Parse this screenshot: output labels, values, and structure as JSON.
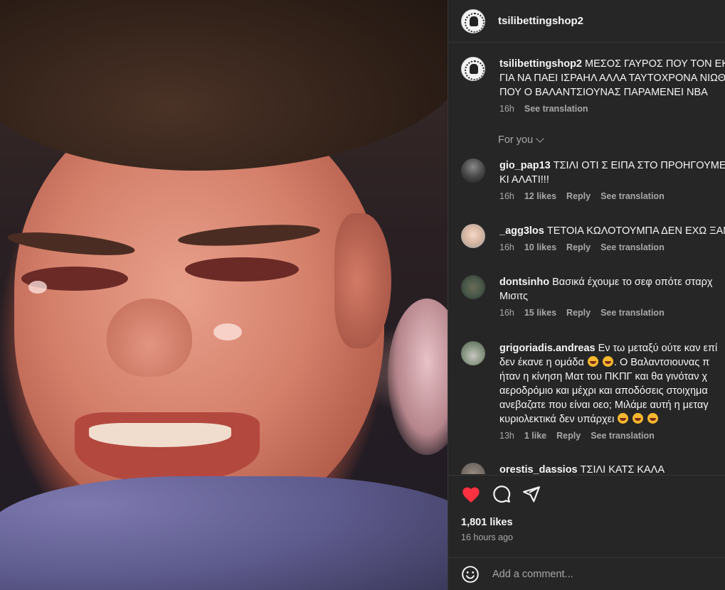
{
  "post": {
    "username": "tsilibettingshop2",
    "caption": {
      "username": "tsilibettingshop2",
      "lines": [
        "ΜΕΣΟΣ ΓΑΥΡΟΣ ΠΟΥ ΤΟΝ ΕΚ",
        "ΓΙΑ ΝΑ ΠΑΕΙ ΙΣΡΑΗΛ ΑΛΛΑ ΤΑΥΤΟΧΡΟΝΑ ΝΙΩΘ",
        "ΠΟΥ Ο ΒΑΛΑΝΤΣΙΟΥΝΑΣ ΠΑΡΑΜΕΝΕΙ ΝΒΑ"
      ],
      "time": "16h",
      "see_translation": "See translation"
    },
    "filter_label": "For you",
    "comments": [
      {
        "username": "gio_pap13",
        "lines": [
          "ΤΣΙΛΙ ΟΤΙ Σ ΕΙΠΑ ΣΤΟ ΠΡΟΗΓΟΥΜΕΝ",
          "ΚΙ ΑΛΑΤΙ!!!"
        ],
        "time": "16h",
        "likes": "12 likes",
        "reply": "Reply",
        "see_translation": "See translation"
      },
      {
        "username": "_agg3los",
        "lines": [
          "ΤΕΤΟΙΑ ΚΩΛΟΤΟΥΜΠΑ ΔΕΝ ΕΧΩ ΞΑΝ"
        ],
        "time": "16h",
        "likes": "10 likes",
        "reply": "Reply",
        "see_translation": "See translation"
      },
      {
        "username": "dontsinho",
        "lines": [
          "Βασικά έχουμε το σεφ οπότε σταρχ",
          "Μισιτς"
        ],
        "time": "16h",
        "likes": "15 likes",
        "reply": "Reply",
        "see_translation": "See translation"
      },
      {
        "username": "grigoriadis.andreas",
        "lines": [
          "Εν τω μεταξύ ούτε καν επί",
          "δεν έκανε η ομάδα",
          ". Ο Βαλαντσιουνας π",
          "ήταν η κίνηση Ματ του ΠΚΠΓ και θα γινόταν χ",
          "αεροδρόμιο και μέχρι και αποδόσεις στοιχημα",
          "ανεβαζατε που είναι οεο; Μιλάμε αυτή η μεταγ",
          "κυριολεκτικά δεν υπάρχει"
        ],
        "time": "13h",
        "likes": "1 like",
        "reply": "Reply",
        "see_translation": "See translation"
      },
      {
        "username": "orestis_dassios",
        "lines": [
          "ΤΣΙΛΙ ΚΑΤΣ ΚΑΛΑ"
        ]
      }
    ],
    "likes_count": "1,801 likes",
    "posted_ago": "16 hours ago",
    "add_comment_placeholder": "Add a comment...",
    "icons": {
      "heart": "heart-icon",
      "comment": "comment-icon",
      "share": "share-icon",
      "emoji": "emoji-icon",
      "chevron": "chevron-down-icon"
    },
    "colors": {
      "panel_bg": "#262626",
      "heart": "#ff3040",
      "secondary_text": "#a8a8a8",
      "primary_text": "#f5f5f5"
    }
  }
}
